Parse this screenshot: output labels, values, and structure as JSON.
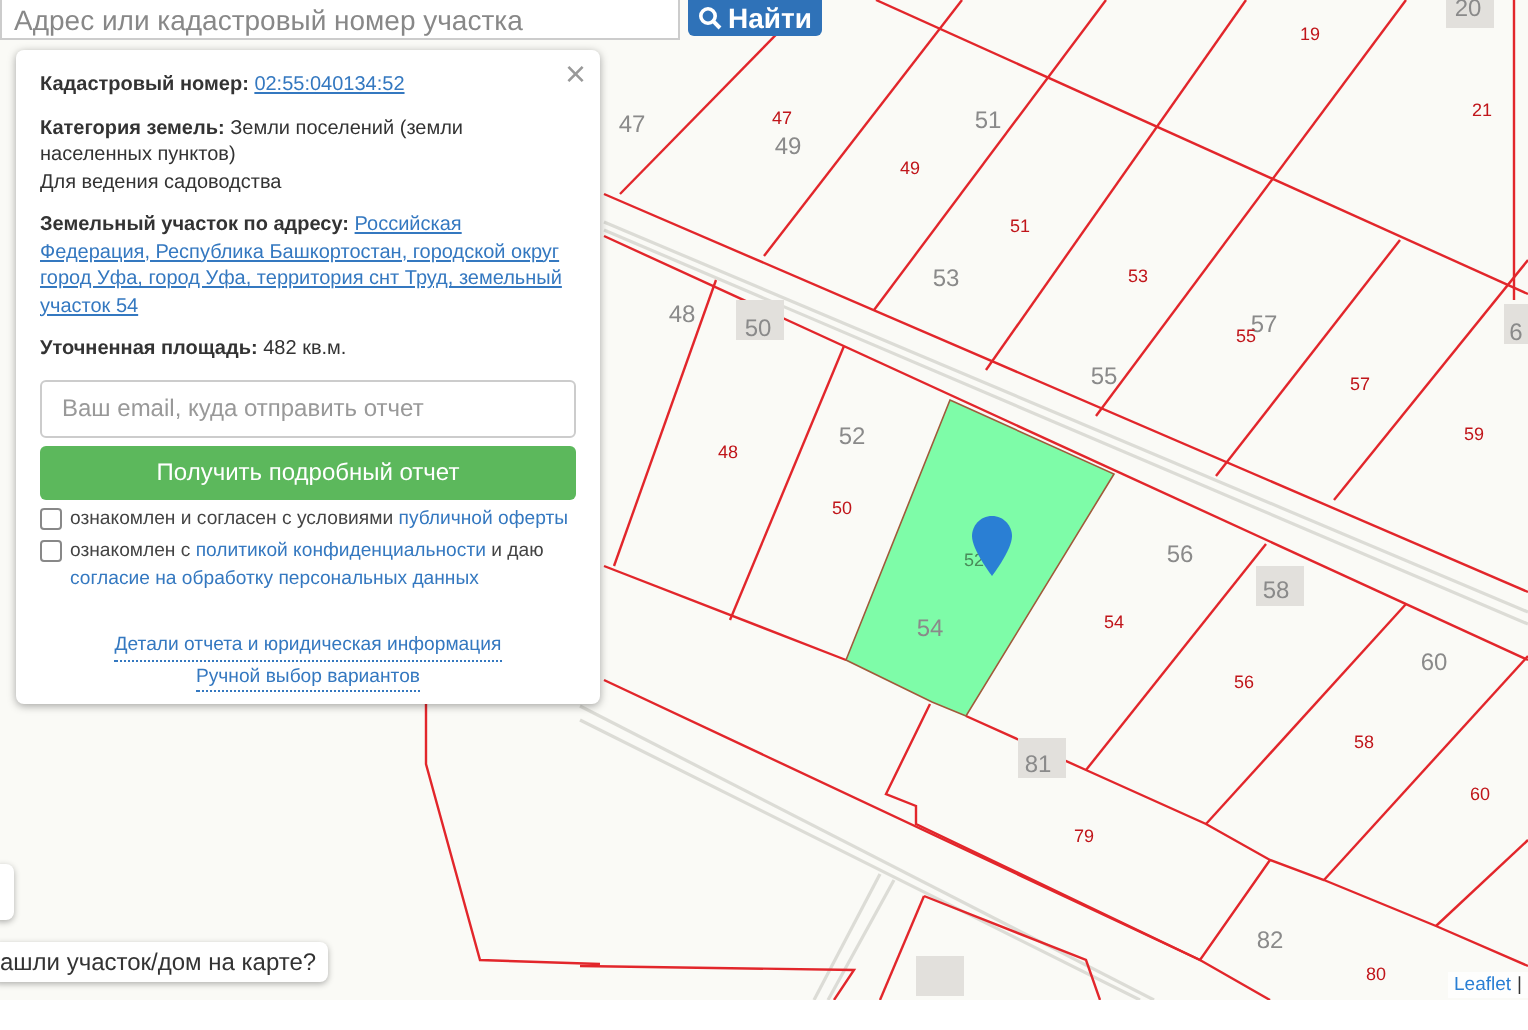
{
  "search": {
    "placeholder": "Адрес или кадастровый номер участка",
    "button": "Найти"
  },
  "popup": {
    "close": "×",
    "fields": [
      {
        "label": "Кадастровый номер:",
        "value": "02:55:040134:52",
        "link": true
      },
      {
        "label": "Категория земель:",
        "value": "Земли поселений (земли населенных пунктов)",
        "link": false
      },
      {
        "label": "Земельный участок по адресу:",
        "value": "Российская Федерация, Республика Башкортостан, городской округ город Уфа, город Уфа, территория снт Труд, земельный участок 54",
        "link": true
      },
      {
        "label": "Уточненная площадь:",
        "value": "482 кв.м.",
        "link": false
      }
    ],
    "use": "Для ведения садоводства",
    "email": {
      "placeholder": "Ваш email, куда отправить отчет"
    },
    "submit": "Получить подробный отчет",
    "consents": [
      {
        "checked": false,
        "parts": [
          {
            "text": "ознакомлен и согласен с условиями ",
            "link": false
          },
          {
            "text": "публичной оферты",
            "link": true
          }
        ]
      },
      {
        "checked": false,
        "parts": [
          {
            "text": "ознакомлен с ",
            "link": false
          },
          {
            "text": "политикой конфиденциальности",
            "link": true
          },
          {
            "text": " и даю ",
            "link": false
          },
          {
            "text": "согласие на обработку персональных данных",
            "link": true
          }
        ]
      }
    ],
    "links": [
      "Детали отчета и юридическая информация",
      "Ручной выбор вариантов"
    ]
  },
  "map": {
    "labels": [
      {
        "text": "47",
        "kind": "plot"
      },
      {
        "text": "49",
        "kind": "plot"
      },
      {
        "text": "51",
        "kind": "plot"
      },
      {
        "text": "53",
        "kind": "plot"
      },
      {
        "text": "48",
        "kind": "plot"
      },
      {
        "text": "50",
        "kind": "plot"
      },
      {
        "text": "57",
        "kind": "plot"
      },
      {
        "text": "55",
        "kind": "plot"
      },
      {
        "text": "52",
        "kind": "plot"
      },
      {
        "text": "56",
        "kind": "plot"
      },
      {
        "text": "58",
        "kind": "plot"
      },
      {
        "text": "54",
        "kind": "plot"
      },
      {
        "text": "60",
        "kind": "plot"
      },
      {
        "text": "81",
        "kind": "plot"
      },
      {
        "text": "82",
        "kind": "plot"
      },
      {
        "text": "20",
        "kind": "plot"
      },
      {
        "text": "6",
        "kind": "plot"
      },
      {
        "text": "52",
        "kind": "cadastral-dark"
      },
      {
        "text": "47",
        "kind": "cadastral"
      },
      {
        "text": "49",
        "kind": "cadastral"
      },
      {
        "text": "51",
        "kind": "cadastral"
      },
      {
        "text": "53",
        "kind": "cadastral"
      },
      {
        "text": "55",
        "kind": "cadastral"
      },
      {
        "text": "57",
        "kind": "cadastral"
      },
      {
        "text": "19",
        "kind": "cadastral"
      },
      {
        "text": "21",
        "kind": "cadastral"
      },
      {
        "text": "59",
        "kind": "cadastral"
      },
      {
        "text": "48",
        "kind": "cadastral"
      },
      {
        "text": "50",
        "kind": "cadastral"
      },
      {
        "text": "54",
        "kind": "cadastral"
      },
      {
        "text": "56",
        "kind": "cadastral"
      },
      {
        "text": "58",
        "kind": "cadastral"
      },
      {
        "text": "60",
        "kind": "cadastral"
      },
      {
        "text": "79",
        "kind": "cadastral"
      },
      {
        "text": "80",
        "kind": "cadastral"
      }
    ],
    "hint": "ашли участок/дом на карте?",
    "attribution": {
      "link": "Leaflet",
      "rest": "|"
    }
  }
}
